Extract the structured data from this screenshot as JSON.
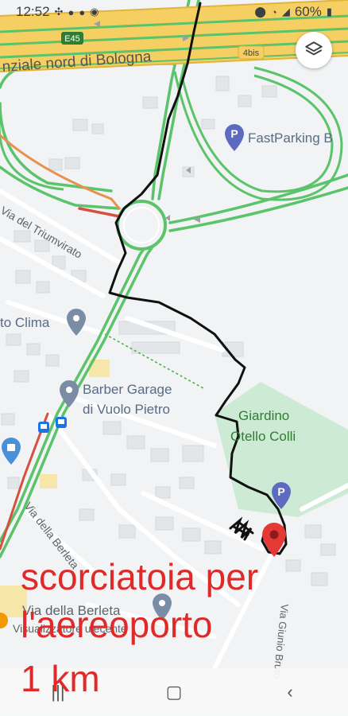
{
  "status": {
    "time": "12:52",
    "battery": "60%"
  },
  "map": {
    "road_badges": {
      "e45": "E45",
      "bis": "4bis"
    },
    "road_name_top": "nziale nord di Bologna",
    "streets": {
      "triumvirato": "Via del Triumvirato",
      "berleta_diag": "Via della Berleta",
      "berleta": "Via della Berleta",
      "bruto": "Via Giunio Bruto"
    },
    "pois": {
      "fastparking": "FastParking B",
      "clima": "to Clima",
      "barber_line1": "Barber Garage",
      "barber_line2": "di Vuolo Pietro",
      "garden_line1": "Giardino",
      "garden_line2": "Otello Colli",
      "visualizzatore": "Visualizzatore ulecente"
    }
  },
  "annotation": {
    "line1": "scorciatoia per",
    "line2": "l'aereoporto",
    "line3": "1 km"
  },
  "colors": {
    "highway": "#f6cf63",
    "highway_edge": "#e2b43a",
    "green_road": "#5bc36a",
    "red_road": "#d5513f",
    "park": "#cdebd4",
    "annotation": "#e02a2a",
    "marker": "#e53935"
  },
  "icons": {
    "layers": "layers-icon",
    "location": "location-status-icon",
    "wifi": "wifi-icon",
    "signal": "signal-icon",
    "battery": "battery-icon",
    "nav": [
      "recent-apps-icon",
      "home-icon",
      "back-icon"
    ]
  }
}
